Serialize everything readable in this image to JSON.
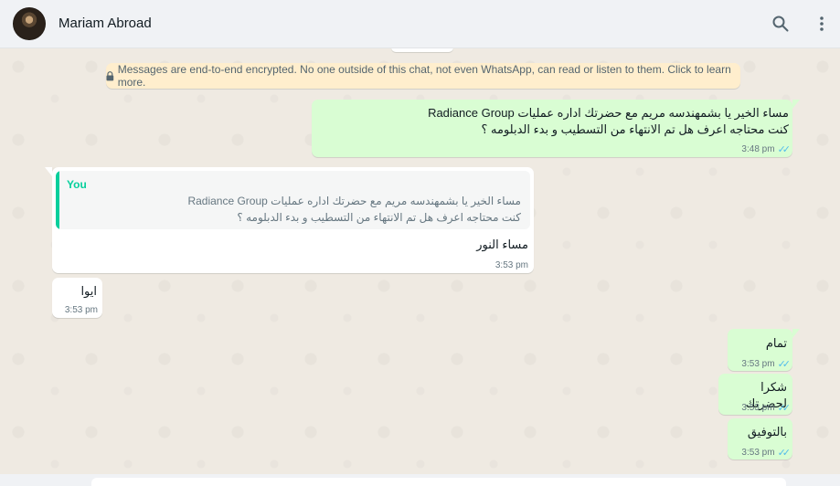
{
  "header": {
    "contact_name": "Mariam Abroad"
  },
  "notice": {
    "text": "Messages are end-to-end encrypted. No one outside of this chat, not even WhatsApp, can read or listen to them. Click to learn more."
  },
  "messages": [
    {
      "direction": "outgoing",
      "text": "مساء الخير يا بشمهندسه مريم   مع حضرتك اداره عمليات Radiance Group\nكنت محتاجه اعرف هل تم الانتهاء من التسطيب و بدء الدبلومه ؟",
      "time": "3:48 pm",
      "ticks": "✓✓"
    },
    {
      "direction": "incoming",
      "quote_author": "You",
      "quote_text": "مساء الخير يا بشمهندسه مريم   مع حضرتك اداره عمليات Radiance Group\nكنت محتاجه اعرف هل تم الانتهاء من التسطيب و بدء الدبلومه ؟",
      "text": "مساء النور",
      "time": "3:53 pm"
    },
    {
      "direction": "incoming",
      "text": "ايوا",
      "time": "3:53 pm"
    },
    {
      "direction": "outgoing",
      "text": "تمام",
      "time": "3:53 pm",
      "ticks": "✓✓"
    },
    {
      "direction": "outgoing",
      "text": "شكرا لحضرتك",
      "time": "3:53 pm",
      "ticks": "✓✓"
    },
    {
      "direction": "outgoing",
      "text": "بالتوفيق",
      "time": "3:53 pm",
      "ticks": "✓✓"
    }
  ],
  "colors": {
    "outgoing_bubble": "#d9fdd3",
    "incoming_bubble": "#ffffff",
    "notice_bg": "#ffeecd",
    "quote_accent": "#06cf9c",
    "read_ticks": "#53bdeb"
  },
  "icons": [
    "search-icon",
    "menu-icon",
    "lock-icon"
  ]
}
